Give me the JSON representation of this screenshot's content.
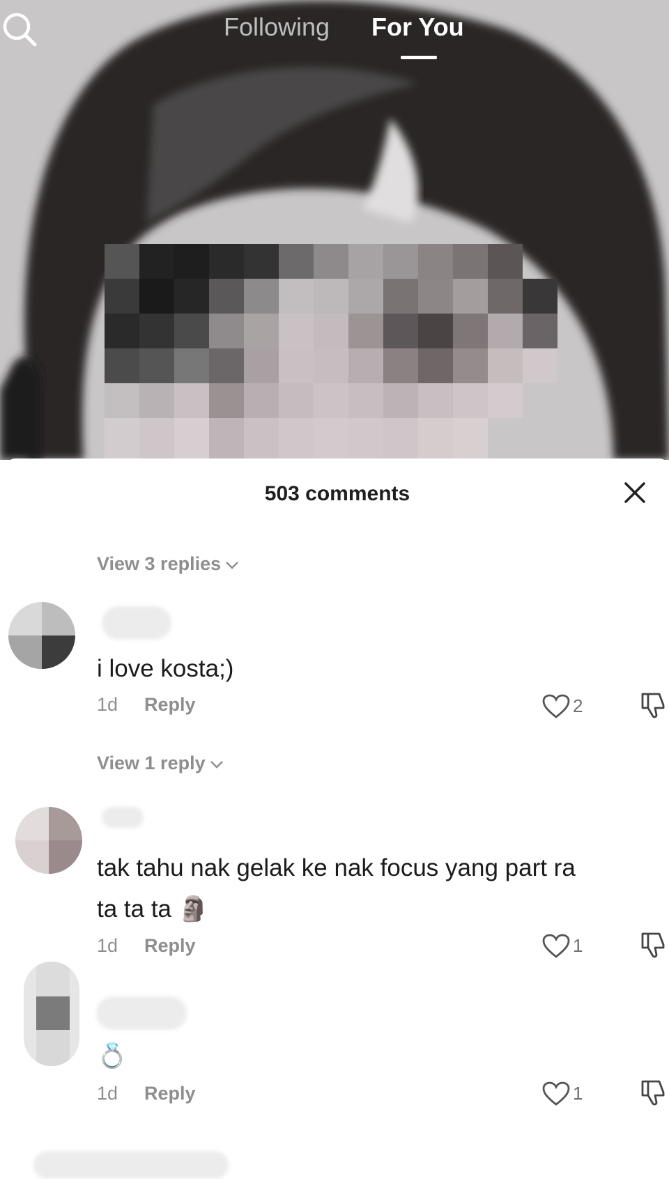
{
  "top_nav": {
    "following": "Following",
    "for_you": "For You"
  },
  "sheet": {
    "title": "503 comments"
  },
  "comments": [
    {
      "view_replies": "View 3 replies"
    },
    {
      "text": "i love kosta;)",
      "time": "1d",
      "reply": "Reply",
      "likes": "2",
      "view_replies": "View 1 reply"
    },
    {
      "text_line1": "tak tahu nak gelak ke nak focus yang part ra",
      "text_line2": "ta ta ta",
      "emoji": "🗿",
      "time": "1d",
      "reply": "Reply",
      "likes": "1"
    },
    {
      "emoji": "💍",
      "time": "1d",
      "reply": "Reply",
      "likes": "1"
    }
  ],
  "icons": [
    "search-icon",
    "close-icon",
    "chevron-down-icon",
    "heart-icon",
    "dislike-icon"
  ],
  "colors": {
    "text": "#1b1b1b",
    "muted": "#8e8e8e",
    "sheet": "#ffffff"
  }
}
